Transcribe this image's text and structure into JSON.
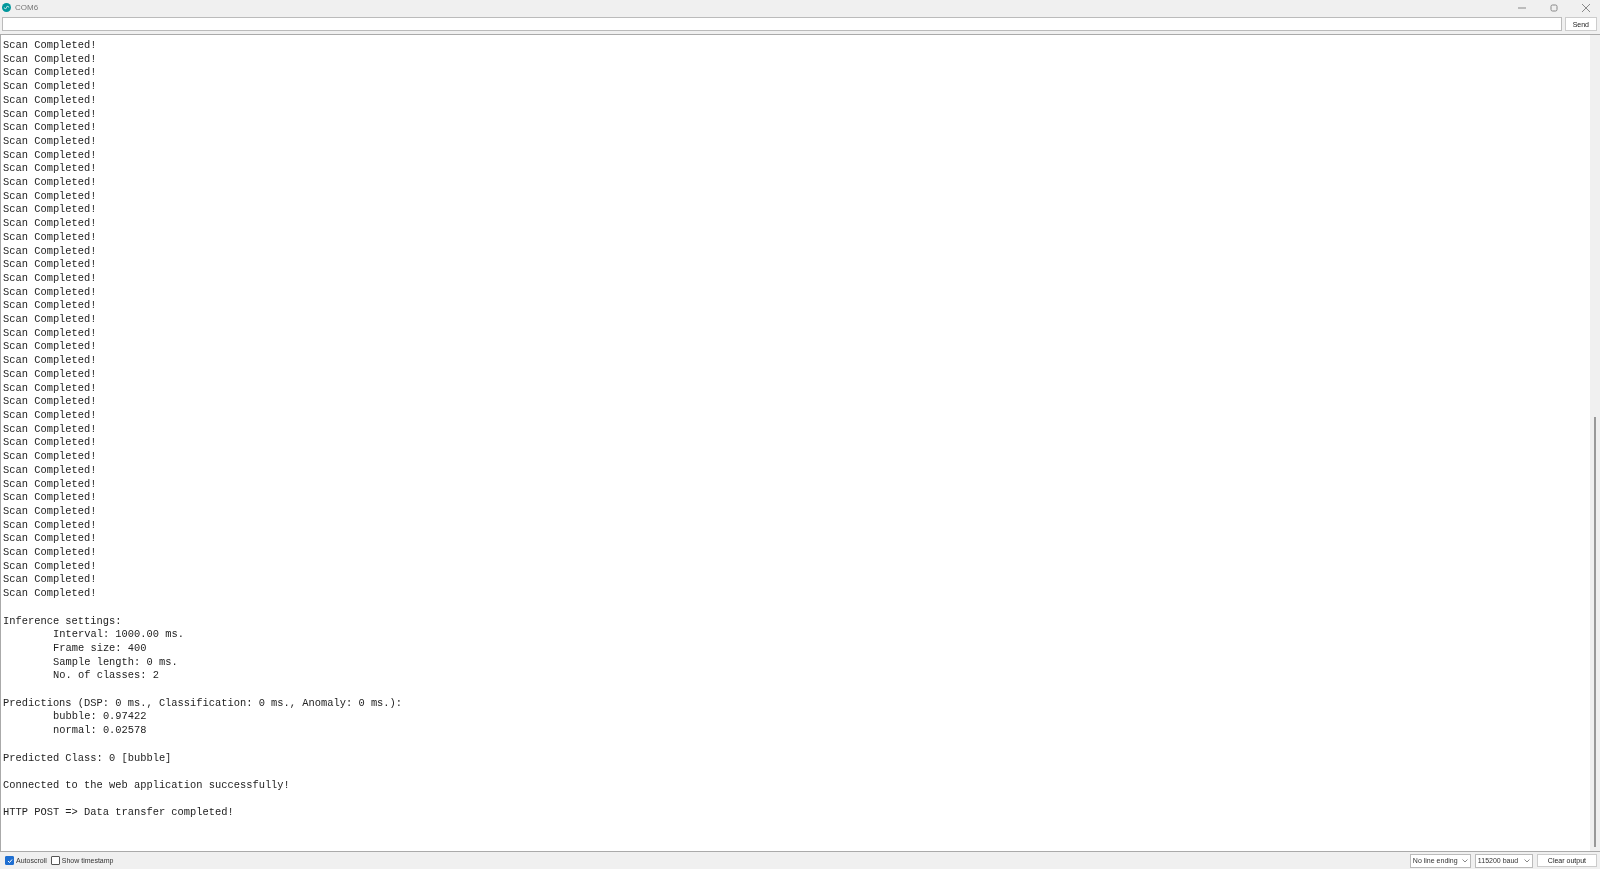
{
  "window": {
    "title": "COM6"
  },
  "send_button": "Send",
  "output": {
    "blocks": [
      {
        "lines": [
          {
            "text": "Scan Completed!",
            "indented": false
          },
          {
            "text": "Scan Completed!",
            "indented": false
          },
          {
            "text": "Scan Completed!",
            "indented": false
          },
          {
            "text": "Scan Completed!",
            "indented": false
          },
          {
            "text": "Scan Completed!",
            "indented": false
          },
          {
            "text": "Scan Completed!",
            "indented": false
          },
          {
            "text": "Scan Completed!",
            "indented": false
          },
          {
            "text": "Scan Completed!",
            "indented": false
          },
          {
            "text": "Scan Completed!",
            "indented": false
          },
          {
            "text": "Scan Completed!",
            "indented": false
          },
          {
            "text": "Scan Completed!",
            "indented": false
          },
          {
            "text": "Scan Completed!",
            "indented": false
          },
          {
            "text": "Scan Completed!",
            "indented": false
          },
          {
            "text": "Scan Completed!",
            "indented": false
          },
          {
            "text": "Scan Completed!",
            "indented": false
          },
          {
            "text": "Scan Completed!",
            "indented": false
          },
          {
            "text": "Scan Completed!",
            "indented": false
          },
          {
            "text": "Scan Completed!",
            "indented": false
          },
          {
            "text": "Scan Completed!",
            "indented": false
          },
          {
            "text": "Scan Completed!",
            "indented": false
          },
          {
            "text": "Scan Completed!",
            "indented": false
          },
          {
            "text": "Scan Completed!",
            "indented": false
          },
          {
            "text": "Scan Completed!",
            "indented": false
          },
          {
            "text": "Scan Completed!",
            "indented": false
          },
          {
            "text": "Scan Completed!",
            "indented": false
          },
          {
            "text": "Scan Completed!",
            "indented": false
          },
          {
            "text": "Scan Completed!",
            "indented": false
          },
          {
            "text": "Scan Completed!",
            "indented": false
          },
          {
            "text": "Scan Completed!",
            "indented": false
          },
          {
            "text": "Scan Completed!",
            "indented": false
          },
          {
            "text": "Scan Completed!",
            "indented": false
          },
          {
            "text": "Scan Completed!",
            "indented": false
          },
          {
            "text": "Scan Completed!",
            "indented": false
          },
          {
            "text": "Scan Completed!",
            "indented": false
          },
          {
            "text": "Scan Completed!",
            "indented": false
          },
          {
            "text": "Scan Completed!",
            "indented": false
          },
          {
            "text": "Scan Completed!",
            "indented": false
          },
          {
            "text": "Scan Completed!",
            "indented": false
          },
          {
            "text": "Scan Completed!",
            "indented": false
          },
          {
            "text": "Scan Completed!",
            "indented": false
          },
          {
            "text": "Scan Completed!",
            "indented": false
          }
        ]
      },
      {
        "lines": [
          {
            "text": "Inference settings:",
            "indented": false
          },
          {
            "text": "Interval: 1000.00 ms.",
            "indented": true
          },
          {
            "text": "Frame size: 400",
            "indented": true
          },
          {
            "text": "Sample length: 0 ms.",
            "indented": true
          },
          {
            "text": "No. of classes: 2",
            "indented": true
          }
        ]
      },
      {
        "lines": [
          {
            "text": "Predictions (DSP: 0 ms., Classification: 0 ms., Anomaly: 0 ms.):",
            "indented": false
          },
          {
            "text": "bubble: 0.97422",
            "indented": true
          },
          {
            "text": "normal: 0.02578",
            "indented": true
          }
        ]
      },
      {
        "lines": [
          {
            "text": "Predicted Class: 0 [bubble]",
            "indented": false
          }
        ]
      },
      {
        "lines": [
          {
            "text": "Connected to the web application successfully!",
            "indented": false
          }
        ]
      },
      {
        "lines": [
          {
            "text": "HTTP POST => Data transfer completed!",
            "indented": false
          }
        ]
      }
    ]
  },
  "status_bar": {
    "options": [
      {
        "label": "Autoscroll",
        "checked": true
      },
      {
        "label": "Show timestamp",
        "checked": false
      }
    ],
    "line_ending": "No line ending",
    "baud_rate": "115200 baud",
    "clear_button": "Clear output"
  }
}
